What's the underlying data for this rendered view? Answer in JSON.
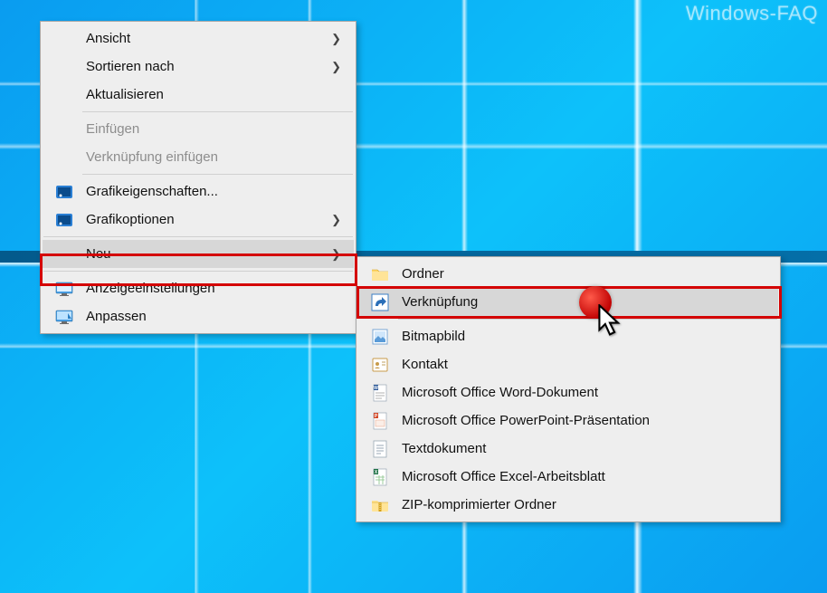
{
  "watermark": "Windows-FAQ",
  "contextMenu": {
    "view": "Ansicht",
    "sortBy": "Sortieren nach",
    "refresh": "Aktualisieren",
    "paste": "Einfügen",
    "pasteShortcut": "Verknüpfung einfügen",
    "graphicsProps": "Grafikeigenschaften...",
    "graphicsOpts": "Grafikoptionen",
    "new": "Neu",
    "displaySettings": "Anzeigeeinstellungen",
    "personalize": "Anpassen"
  },
  "newMenu": {
    "folder": "Ordner",
    "shortcut": "Verknüpfung",
    "bitmap": "Bitmapbild",
    "contact": "Kontakt",
    "wordDoc": "Microsoft Office Word-Dokument",
    "powerpoint": "Microsoft Office PowerPoint-Präsentation",
    "textDoc": "Textdokument",
    "excel": "Microsoft Office Excel-Arbeitsblatt",
    "zip": "ZIP-komprimierter Ordner"
  }
}
